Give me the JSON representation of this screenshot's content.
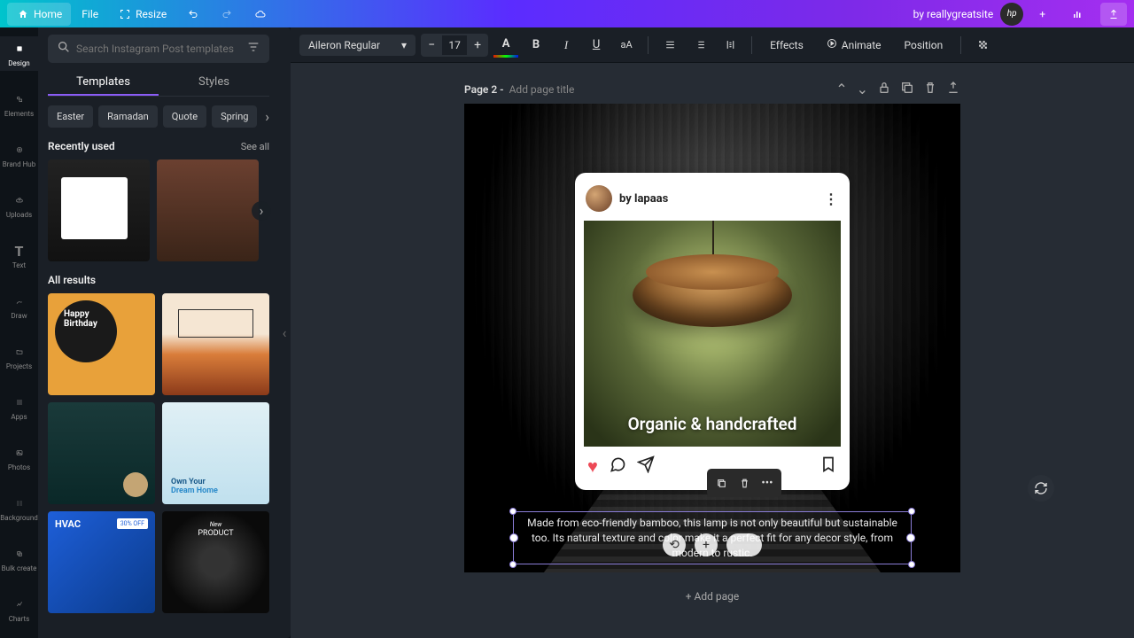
{
  "topbar": {
    "home": "Home",
    "file": "File",
    "resize": "Resize",
    "by": "by reallygreatsite"
  },
  "rail": {
    "design": "Design",
    "elements": "Elements",
    "brandhub": "Brand Hub",
    "uploads": "Uploads",
    "text": "Text",
    "draw": "Draw",
    "projects": "Projects",
    "apps": "Apps",
    "photos": "Photos",
    "background": "Background",
    "bulkcreate": "Bulk create",
    "charts": "Charts"
  },
  "panel": {
    "search_placeholder": "Search Instagram Post templates",
    "tab_templates": "Templates",
    "tab_styles": "Styles",
    "chips": [
      "Easter",
      "Ramadan",
      "Quote",
      "Spring"
    ],
    "recently_used": "Recently used",
    "see_all": "See all",
    "all_results": "All results"
  },
  "toolbar": {
    "font": "Aileron Regular",
    "size": "17",
    "effects": "Effects",
    "animate": "Animate",
    "position": "Position"
  },
  "page": {
    "label": "Page 2 - ",
    "title_placeholder": "Add page title"
  },
  "design": {
    "ig_user": "by lapaas",
    "overlay": "Organic & handcrafted",
    "caption": "Made from eco-friendly bamboo, this lamp is not only beautiful but sustainable too. Its natural texture and color make it a perfect fit for any decor style, from modern to rustic."
  },
  "add_page": "+ Add page"
}
